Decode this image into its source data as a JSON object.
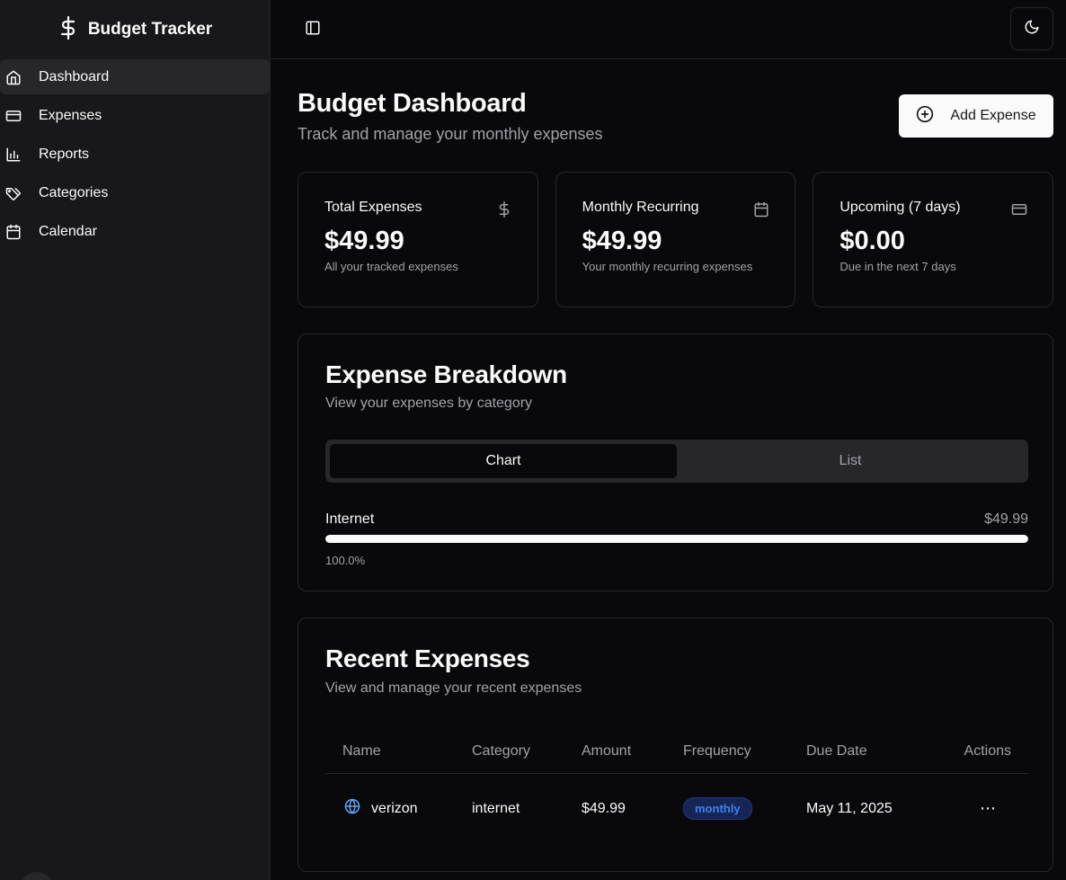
{
  "sidebar": {
    "brand": "Budget Tracker",
    "items": [
      {
        "label": "Dashboard",
        "icon": "home-icon",
        "active": true
      },
      {
        "label": "Expenses",
        "icon": "credit-card-icon"
      },
      {
        "label": "Reports",
        "icon": "bar-chart-icon"
      },
      {
        "label": "Categories",
        "icon": "tags-icon"
      },
      {
        "label": "Calendar",
        "icon": "calendar-icon"
      }
    ]
  },
  "header": {
    "title": "Budget Dashboard",
    "subtitle": "Track and manage your monthly expenses",
    "add_label": "Add Expense"
  },
  "stats": [
    {
      "title": "Total Expenses",
      "value": "$49.99",
      "desc": "All your tracked expenses",
      "icon": "dollar-icon"
    },
    {
      "title": "Monthly Recurring",
      "value": "$49.99",
      "desc": "Your monthly recurring expenses",
      "icon": "calendar-icon"
    },
    {
      "title": "Upcoming (7 days)",
      "value": "$0.00",
      "desc": "Due in the next 7 days",
      "icon": "credit-card-icon"
    }
  ],
  "breakdown": {
    "title": "Expense Breakdown",
    "subtitle": "View your expenses by category",
    "tabs": [
      "Chart",
      "List"
    ],
    "active_tab": "Chart",
    "rows": [
      {
        "category": "Internet",
        "amount": "$49.99",
        "percent_label": "100.0%",
        "fraction": 1.0
      }
    ]
  },
  "recent": {
    "title": "Recent Expenses",
    "subtitle": "View and manage your recent expenses",
    "columns": [
      "Name",
      "Category",
      "Amount",
      "Frequency",
      "Due Date",
      "Actions"
    ],
    "rows": [
      {
        "name": "verizon",
        "icon": "globe-icon",
        "category": "internet",
        "amount": "$49.99",
        "frequency": "monthly",
        "due": "May 11, 2025",
        "actions": "⋯"
      }
    ]
  },
  "colors": {
    "background": "#09090b",
    "sidebar": "#18181b",
    "border": "#27272a",
    "muted_text": "#a1a1aa",
    "badge_blue": "#3b82f6"
  }
}
